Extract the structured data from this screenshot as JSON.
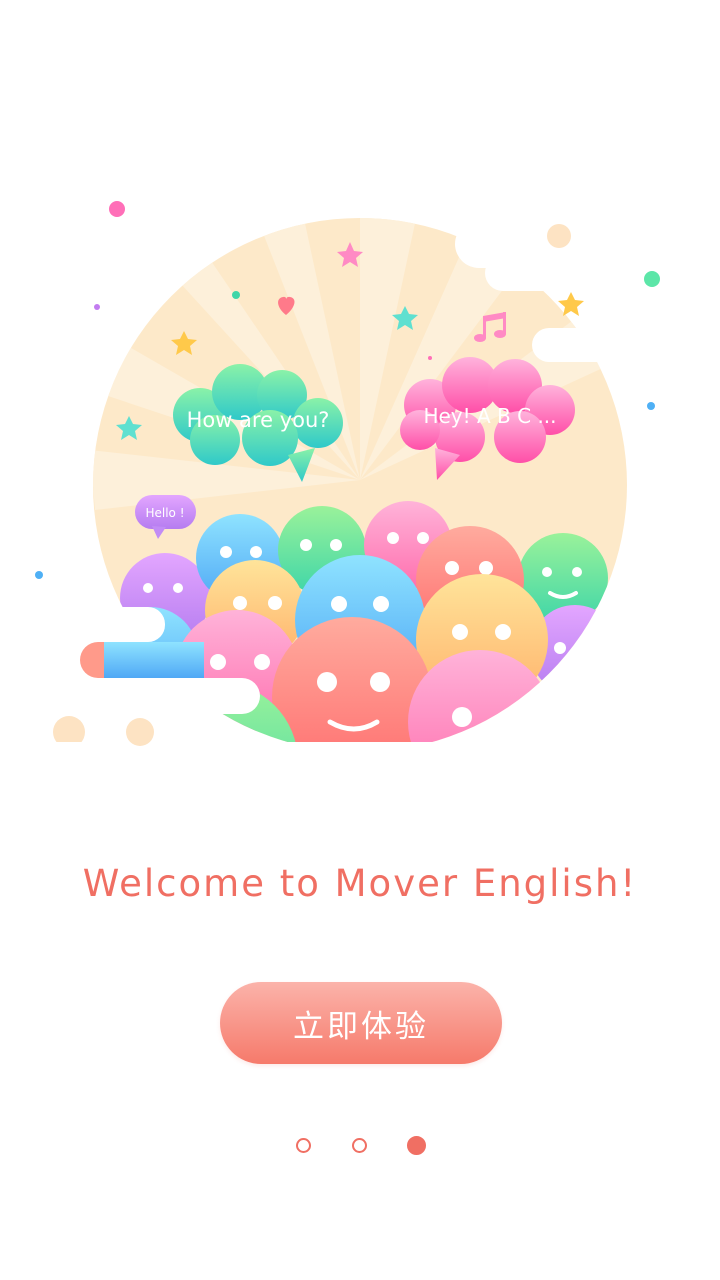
{
  "illustration": {
    "bubble_left": "How are you?",
    "bubble_right": "Hey! A B C ...",
    "bubble_small": "Hello !",
    "colors": {
      "background_disc": "#fde9c9",
      "bubble_left": "#3fd6c2",
      "bubble_right": "#ff6fb2",
      "bubble_small": "#c27cf0"
    }
  },
  "welcome_text": "Welcome to Mover English!",
  "cta_label": "立即体验",
  "pagination": {
    "total": 3,
    "active_index": 2
  },
  "colors": {
    "accent": "#f06f63"
  }
}
